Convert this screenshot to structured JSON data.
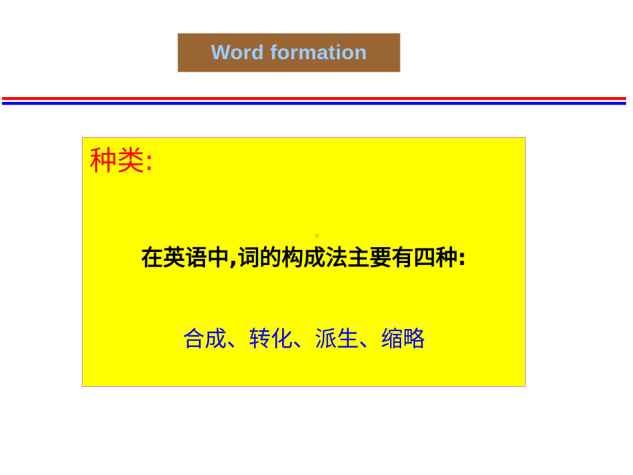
{
  "slide": {
    "title": "Word formation",
    "heading": "种类:",
    "intro": "在英语中,词的构成法主要有四种:",
    "types_line": "合成、转化、派生、缩略",
    "types": [
      "合成",
      "转化",
      "派生",
      "缩略"
    ]
  },
  "colors": {
    "title_bg": "#996633",
    "title_text": "#99ccff",
    "rule_top": "#ff0000",
    "rule_bottom": "#0000ff",
    "box_bg": "#ffff00",
    "heading_text": "#ff0000",
    "intro_text": "#000000",
    "types_text": "#0000ff"
  }
}
